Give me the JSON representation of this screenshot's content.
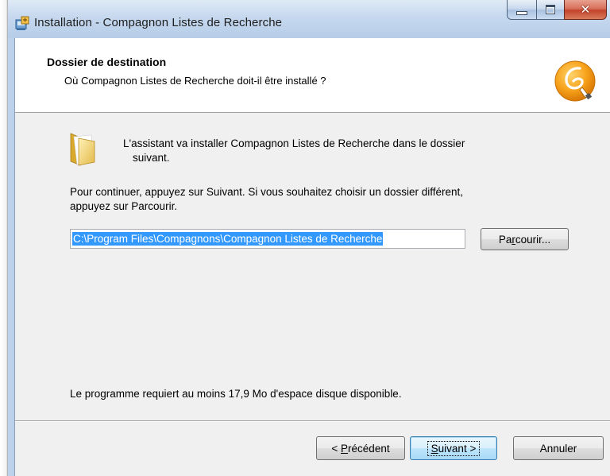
{
  "window": {
    "title": "Installation - Compagnon Listes de Recherche",
    "icons": [
      "installer-app-icon",
      "minimize-icon",
      "maximize-icon",
      "close-icon"
    ],
    "close_glyph": "✕"
  },
  "header": {
    "title": "Dossier de destination",
    "subtitle": "Où Compagnon Listes de Recherche doit-il être installé ?",
    "logo_icon": "compagnon-logo-icon",
    "accent": "#f7a21b"
  },
  "body": {
    "intro_line1": "L'assistant va installer Compagnon Listes de Recherche dans le dossier",
    "intro_line2": "suivant.",
    "continue_line1": "Pour continuer, appuyez sur Suivant. Si vous souhaitez choisir un dossier différent,",
    "continue_line2": "appuyez sur Parcourir.",
    "path_value": "C:\\Program Files\\Compagnons\\Compagnon Listes de Recherche",
    "disk_space": "Le programme requiert au moins 17,9 Mo d'espace disque disponible.",
    "folder_icon": "folder-icon"
  },
  "buttons": {
    "browse": {
      "pre": "Pa",
      "accel": "r",
      "post": "courir..."
    },
    "previous": {
      "pre": "< ",
      "accel": "P",
      "post": "récédent"
    },
    "next": {
      "pre": "",
      "accel": "S",
      "post": "uivant >"
    },
    "cancel": "Annuler"
  },
  "colors": {
    "selection": "#3399ff",
    "default_button_border": "#3c7fb1",
    "client_bg": "#f0f0f0"
  }
}
